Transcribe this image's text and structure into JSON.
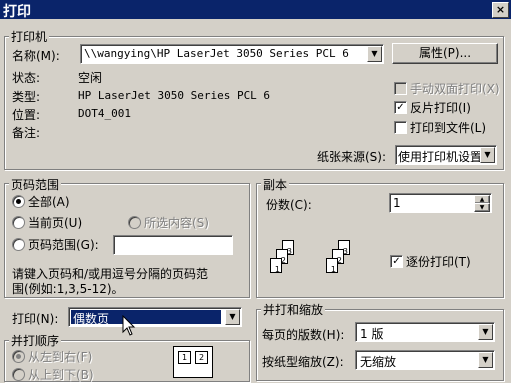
{
  "window": {
    "title": "打印",
    "close_label": "×"
  },
  "printer": {
    "group_label": "打印机",
    "name_label": "名称(M):",
    "name_value": "\\\\wangying\\HP LaserJet 3050 Series PCL 6",
    "properties_button": "属性(P)...",
    "status_label": "状态:",
    "status_value": "空闲",
    "type_label": "类型:",
    "type_value": "HP LaserJet 3050 Series PCL 6",
    "location_label": "位置:",
    "location_value": "DOT4_001",
    "comment_label": "备注:",
    "comment_value": "",
    "duplex_label": "手动双面打印(X)",
    "reverse_label": "反片打印(I)",
    "print_to_file_label": "打印到文件(L)",
    "paper_source_label": "纸张来源(S):",
    "paper_source_value": "使用打印机设置"
  },
  "page_range": {
    "group_label": "页码范围",
    "all_label": "全部(A)",
    "current_label": "当前页(U)",
    "selection_label": "所选内容(S)",
    "pages_label": "页码范围(G):",
    "pages_value": "",
    "hint_line1": "请键入页码和/或用逗号分隔的页码范",
    "hint_line2": "围(例如:1,3,5-12)。"
  },
  "copies": {
    "group_label": "副本",
    "count_label": "份数(C):",
    "count_value": "1",
    "collate_label": "逐份打印(T)"
  },
  "print_what": {
    "label": "打印(N):",
    "value": "偶数页"
  },
  "order": {
    "group_label": "并打顺序",
    "ltr_label": "从左到右(F)",
    "ttb_label": "从上到下(B)"
  },
  "zoom": {
    "group_label": "并打和缩放",
    "pages_per_sheet_label": "每页的版数(H):",
    "pages_per_sheet_value": "1 版",
    "scale_label": "按纸型缩放(Z):",
    "scale_value": "无缩放"
  },
  "glyphs": {
    "dropdown": "▼",
    "check": "✓",
    "spin_up": "▲",
    "spin_down": "▼"
  },
  "collate_pages": [
    "1",
    "2",
    "3",
    "1",
    "2",
    "3"
  ],
  "order_grid": [
    "1",
    "2"
  ]
}
